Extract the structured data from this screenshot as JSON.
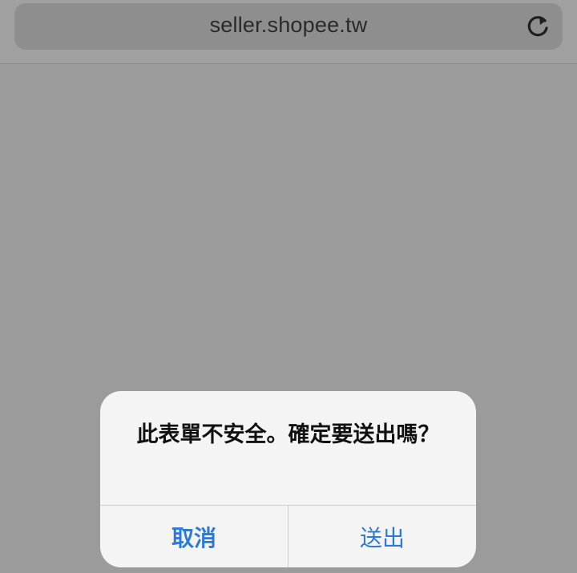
{
  "browser": {
    "url": "seller.shopee.tw",
    "reload_icon": "reload-icon"
  },
  "alert": {
    "message": "此表單不安全。確定要送出嗎？",
    "cancel_label": "取消",
    "confirm_label": "送出"
  },
  "colors": {
    "background": "#9b9b9b",
    "address_bar": "#8e8e8e",
    "alert_bg": "#f4f4f4",
    "button_text": "#2d7ad6"
  }
}
